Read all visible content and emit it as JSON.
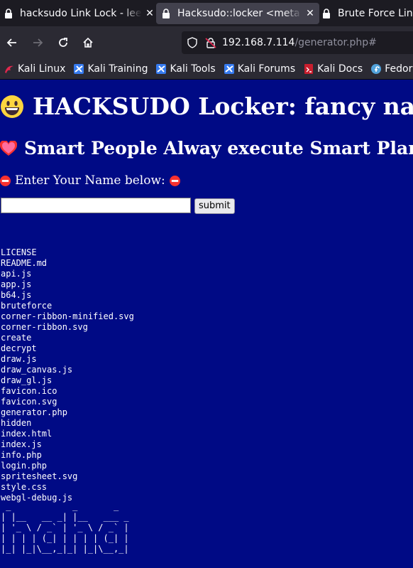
{
  "browser": {
    "tabs": [
      {
        "title": "hacksudo Link Lock - leet",
        "active": false
      },
      {
        "title": "Hacksudo::locker <meta c",
        "active": true
      },
      {
        "title": "Brute Force Link",
        "active": false
      }
    ],
    "url": {
      "host": "192.168.7.114",
      "path": "/generator.php#"
    },
    "bookmarks": [
      {
        "label": "Kali Linux",
        "icon": "kali-dragon-icon"
      },
      {
        "label": "Kali Training",
        "icon": "kali-training-icon"
      },
      {
        "label": "Kali Tools",
        "icon": "kali-tools-icon"
      },
      {
        "label": "Kali Forums",
        "icon": "kali-forums-icon"
      },
      {
        "label": "Kali Docs",
        "icon": "kali-docs-icon"
      },
      {
        "label": "Fedora",
        "icon": "fedora-icon"
      }
    ]
  },
  "page": {
    "title": "HACKSUDO Locker: fancy nam",
    "subtitle": "Smart People Alway execute Smart Plan",
    "prompt": "Enter Your Name below:",
    "name_input": {
      "value": "",
      "placeholder": ""
    },
    "submit_label": "submit",
    "files": [
      "LICENSE",
      "README.md",
      "api.js",
      "app.js",
      "b64.js",
      "bruteforce",
      "corner-ribbon-minified.svg",
      "corner-ribbon.svg",
      "create",
      "decrypt",
      "draw.js",
      "draw_canvas.js",
      "draw_gl.js",
      "favicon.ico",
      "favicon.svg",
      "generator.php",
      "hidden",
      "index.html",
      "index.js",
      "info.php",
      "login.php",
      "spritesheet.svg",
      "style.css",
      "webgl-debug.js"
    ],
    "ascii_art": " _            _       _\n| |__   __ _| |__   ___ _\n| '_ \\ / _` | '_ \\ / _` |\n| | | | (_| | | | | (_| |\n|_| |_|\\__,_|_| |_|\\__,_|"
  },
  "colors": {
    "page_background": "#000a85",
    "text": "#ffffff"
  }
}
